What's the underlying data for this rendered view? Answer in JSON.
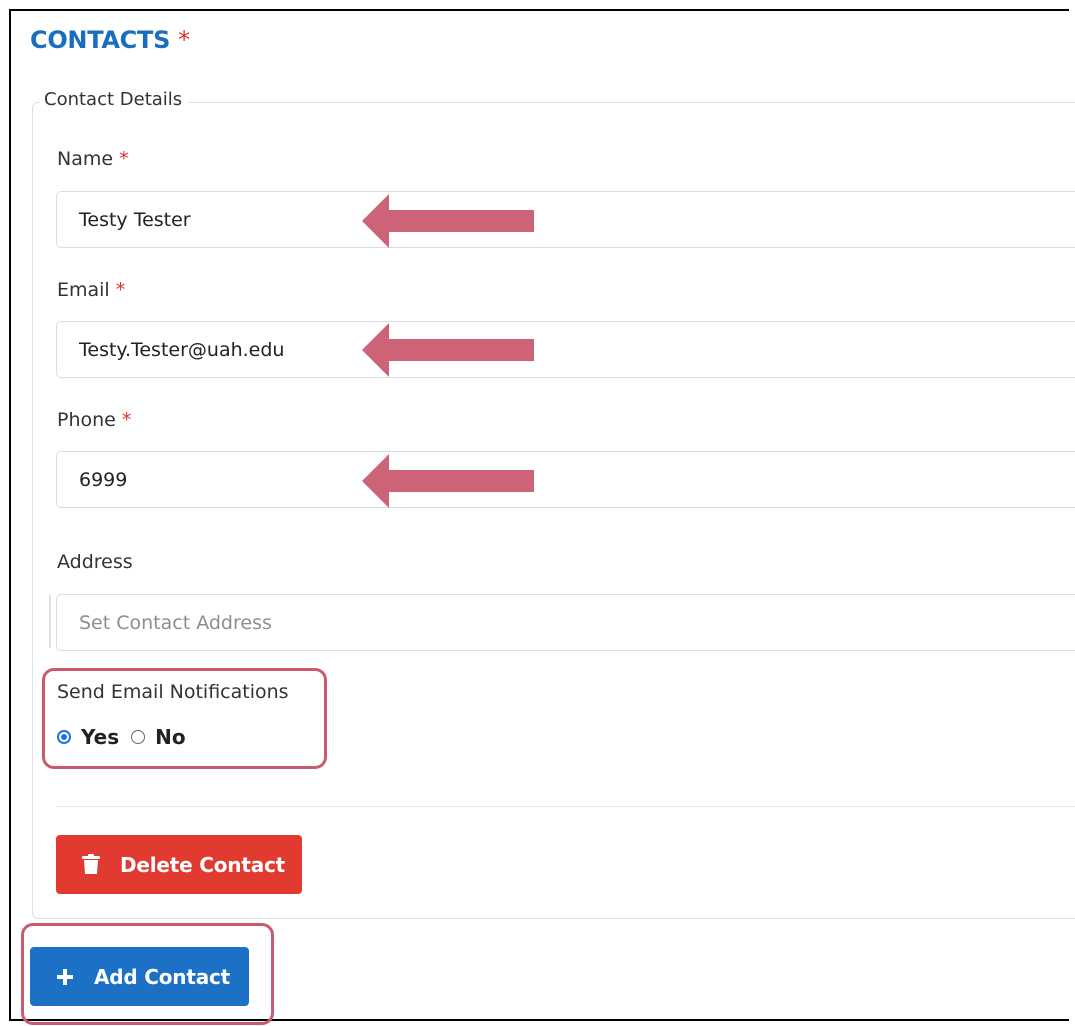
{
  "section": {
    "title": "CONTACTS",
    "required_mark": "*"
  },
  "fieldset": {
    "legend": "Contact Details"
  },
  "fields": {
    "name": {
      "label": "Name",
      "required_mark": "*",
      "value": "Testy Tester"
    },
    "email": {
      "label": "Email",
      "required_mark": "*",
      "value": "Testy.Tester@uah.edu"
    },
    "phone": {
      "label": "Phone",
      "required_mark": "*",
      "value": "6999"
    },
    "address": {
      "label": "Address",
      "placeholder": "Set Contact Address",
      "value": ""
    }
  },
  "notifications": {
    "label": "Send Email Notifications",
    "options": [
      {
        "label": "Yes",
        "checked": true
      },
      {
        "label": "No",
        "checked": false
      }
    ]
  },
  "buttons": {
    "delete": {
      "label": "Delete Contact",
      "icon": "trash-icon"
    },
    "add": {
      "label": "Add Contact",
      "icon": "plus-icon"
    }
  },
  "colors": {
    "title_blue": "#1a6dbf",
    "required_red": "#d9372c",
    "delete_red": "#e03a31",
    "add_blue": "#1c71c6",
    "annotation": "#c95b70",
    "radio_blue": "#1a73e8"
  }
}
